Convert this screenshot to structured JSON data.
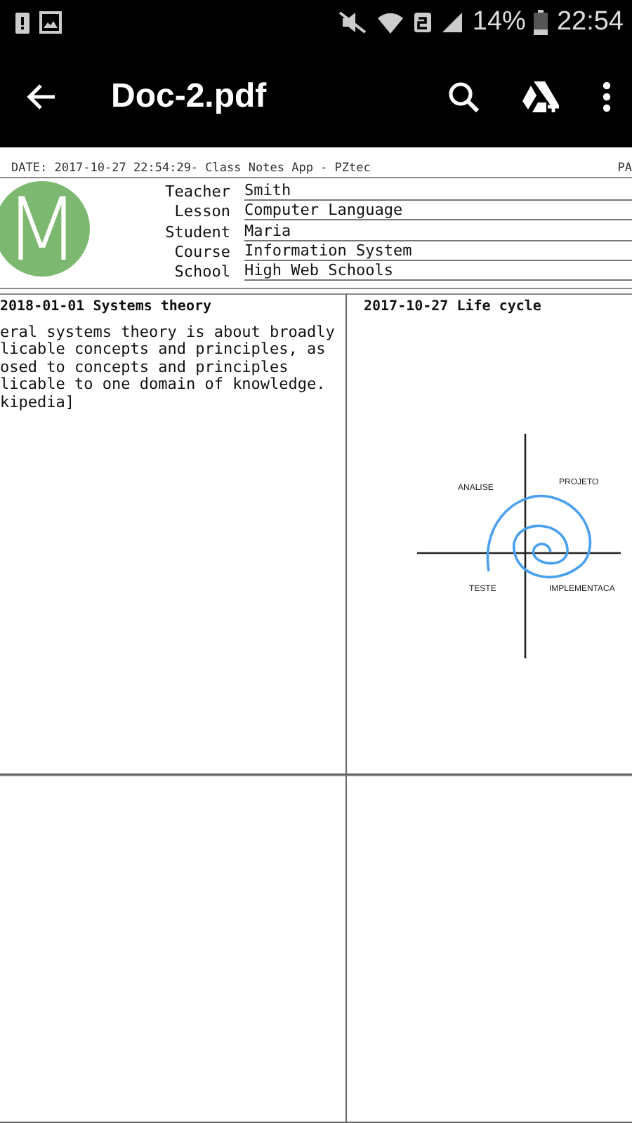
{
  "status_bar": {
    "battery": "14%",
    "time": "22:54"
  },
  "toolbar": {
    "title": "Doc-2.pdf"
  },
  "document": {
    "header": {
      "left": "DATE: 2017-10-27 22:54:29- Class Notes App - PZtec",
      "right": "PA"
    },
    "avatar": {
      "letter": "M",
      "color": "#7cb870"
    },
    "fields": [
      {
        "label": "Teacher",
        "value": "Smith"
      },
      {
        "label": "Lesson",
        "value": "Computer Language"
      },
      {
        "label": "Student",
        "value": "Maria"
      },
      {
        "label": "Course",
        "value": "Information System"
      },
      {
        "label": "School",
        "value": "High Web Schools"
      }
    ],
    "notes": [
      {
        "kind": "text",
        "title": "2018-01-01 Systems theory",
        "lines": [
          "eral systems theory is about broadly",
          "licable concepts and principles, as",
          "osed to concepts and principles",
          "licable to one domain of knowledge.",
          "kipedia]"
        ]
      },
      {
        "kind": "diagram",
        "title": "2017-10-27 Life cycle",
        "labels": [
          "ANALISE",
          "PROJETO",
          "TESTE",
          "IMPLEMENTACA"
        ]
      },
      {
        "kind": "empty"
      },
      {
        "kind": "empty"
      }
    ]
  }
}
